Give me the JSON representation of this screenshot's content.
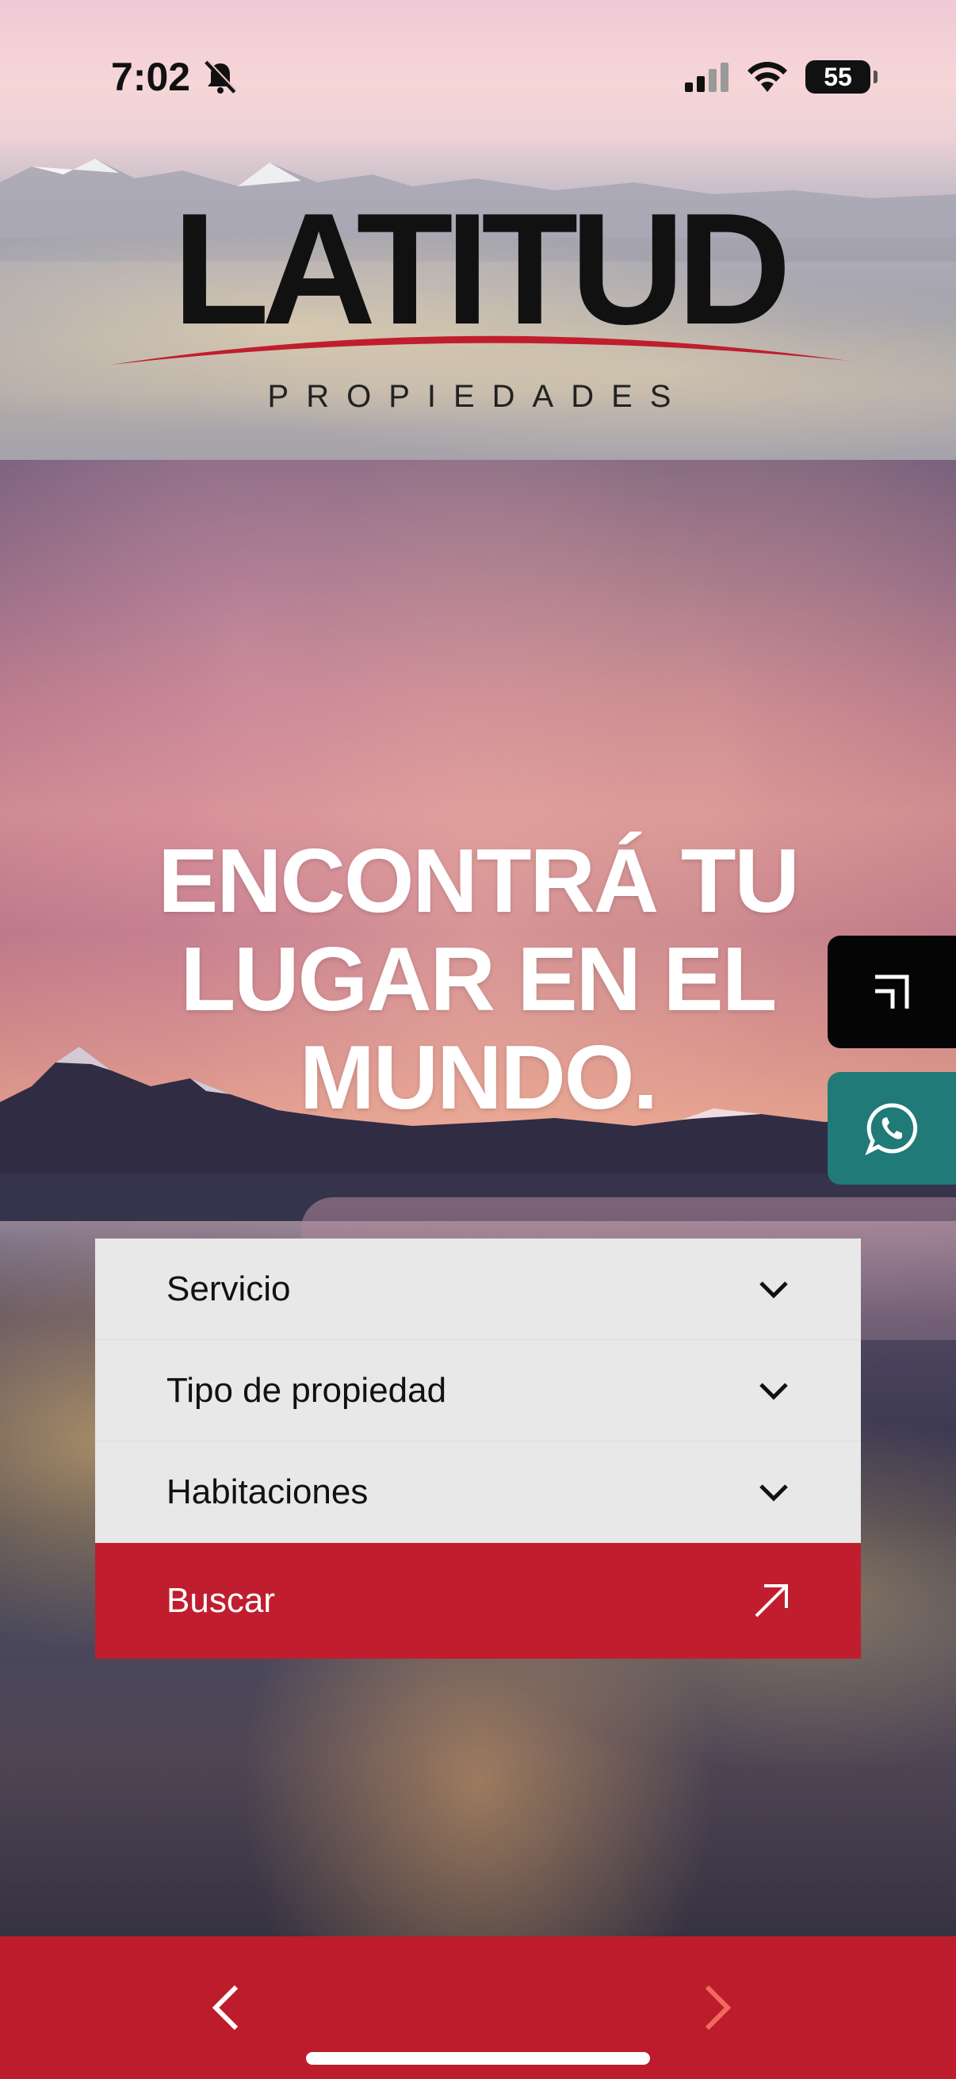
{
  "status_bar": {
    "time": "7:02",
    "battery": "55",
    "icons": [
      "bell-slash-icon",
      "signal-icon",
      "wifi-icon",
      "battery-icon"
    ]
  },
  "header": {
    "logo_title": "LATITUD",
    "logo_subtitle": "PROPIEDADES"
  },
  "hero": {
    "title_lines": [
      "ENCONTRÁ TU",
      "LUGAR EN EL",
      "MUNDO."
    ]
  },
  "side_buttons": {
    "arrow_icon": "corner-arrow-icon",
    "whatsapp_icon": "whatsapp-icon"
  },
  "search_form": {
    "service_label": "Servicio",
    "property_type_label": "Tipo de propiedad",
    "rooms_label": "Habitaciones",
    "search_label": "Buscar"
  },
  "colors": {
    "brand_red": "#c01e2e",
    "whatsapp_teal": "#1f7a78",
    "form_bg": "#e8e8e8"
  }
}
